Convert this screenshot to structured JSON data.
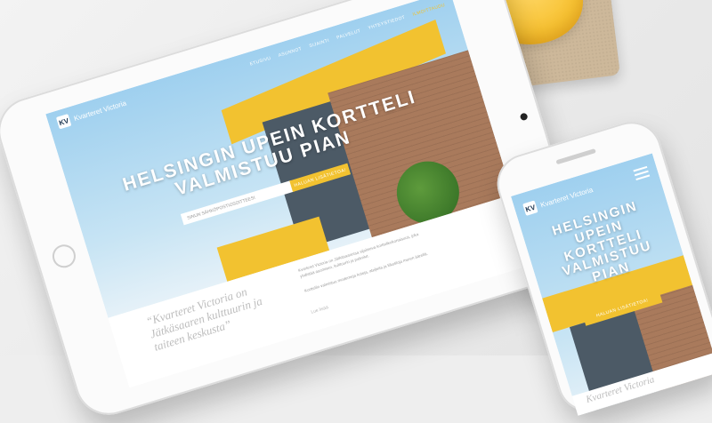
{
  "site": {
    "logo_label": "KV",
    "logo_text": "Kvarteret Victoria",
    "nav": [
      "ETUSIVU",
      "ASUNNOT",
      "SIJAINTI",
      "PALVELUT",
      "YHTEYSTIEDOT",
      "ILMOITTAUDU"
    ],
    "active_nav_index": 5,
    "headline_lines": [
      "HELSINGIN UPEIN KORTTELI",
      "VALMISTUU PIAN"
    ],
    "email_placeholder": "SINUN SÄHKÖPOSTIOSOITTEESI",
    "cta_label": "HALUAN LISÄTIETOA!",
    "quote": "“Kvarteret Victoria on Jätkäsaaren kulttuurin ja taiteen keskusta”",
    "body_paragraphs": [
      "Kvarteret Victoria on Jätkäsaaressa sijaitseva korttelikokonaisuus, joka yhdistää asumisen, kulttuurin ja palvelut.",
      "Kortteliin valmistuu moderneja koteja, ateljeita ja liiketiloja meren äärellä."
    ],
    "read_more": "Lue lisää"
  },
  "phone_site": {
    "logo_text": "Kvarteret Victoria",
    "headline_lines": [
      "HELSINGIN",
      "UPEIN",
      "KORTTELI",
      "VALMISTUU",
      "PIAN"
    ],
    "cta_label": "HALUAN LISÄTIETOA!",
    "quote_start": "Kvarteret Victoria"
  },
  "colors": {
    "accent": "#f2c230",
    "sky": "#9fd0ef",
    "brick": "#a97a5c"
  }
}
